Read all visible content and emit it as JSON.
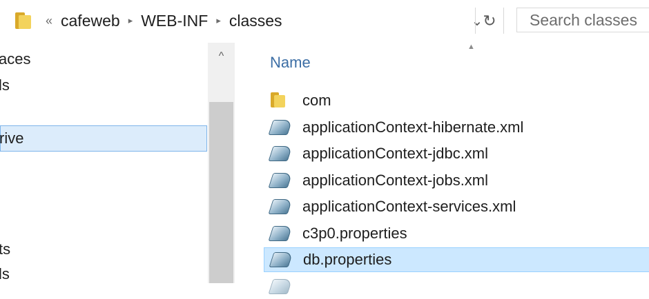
{
  "address_bar": {
    "overflow_chevron": "«",
    "breadcrumbs": [
      "cafeweb",
      "WEB-INF",
      "classes"
    ],
    "separator": "▸",
    "dropdown_glyph": "⌄",
    "refresh_glyph": "↻"
  },
  "search": {
    "placeholder": "Search classes"
  },
  "nav_pane": {
    "items": [
      {
        "label": "aces",
        "selected": false
      },
      {
        "label": "ls",
        "selected": false
      },
      {
        "label": "rive",
        "selected": true
      },
      {
        "label": "ts",
        "selected": false
      },
      {
        "label": "ls",
        "selected": false
      }
    ],
    "scroll_up_glyph": "^"
  },
  "file_list": {
    "column_header": "Name",
    "sort_glyph": "▲",
    "rows": [
      {
        "name": "com",
        "type": "folder",
        "selected": false
      },
      {
        "name": "applicationContext-hibernate.xml",
        "type": "file",
        "selected": false
      },
      {
        "name": "applicationContext-jdbc.xml",
        "type": "file",
        "selected": false
      },
      {
        "name": "applicationContext-jobs.xml",
        "type": "file",
        "selected": false
      },
      {
        "name": "applicationContext-services.xml",
        "type": "file",
        "selected": false
      },
      {
        "name": "c3p0.properties",
        "type": "file",
        "selected": false
      },
      {
        "name": "db.properties",
        "type": "file",
        "selected": true
      }
    ]
  },
  "colors": {
    "selection_bg": "#cce8ff",
    "selection_border": "#99d1ff",
    "header_text": "#3c6ea5",
    "folder_yellow": "#f3d35c"
  }
}
